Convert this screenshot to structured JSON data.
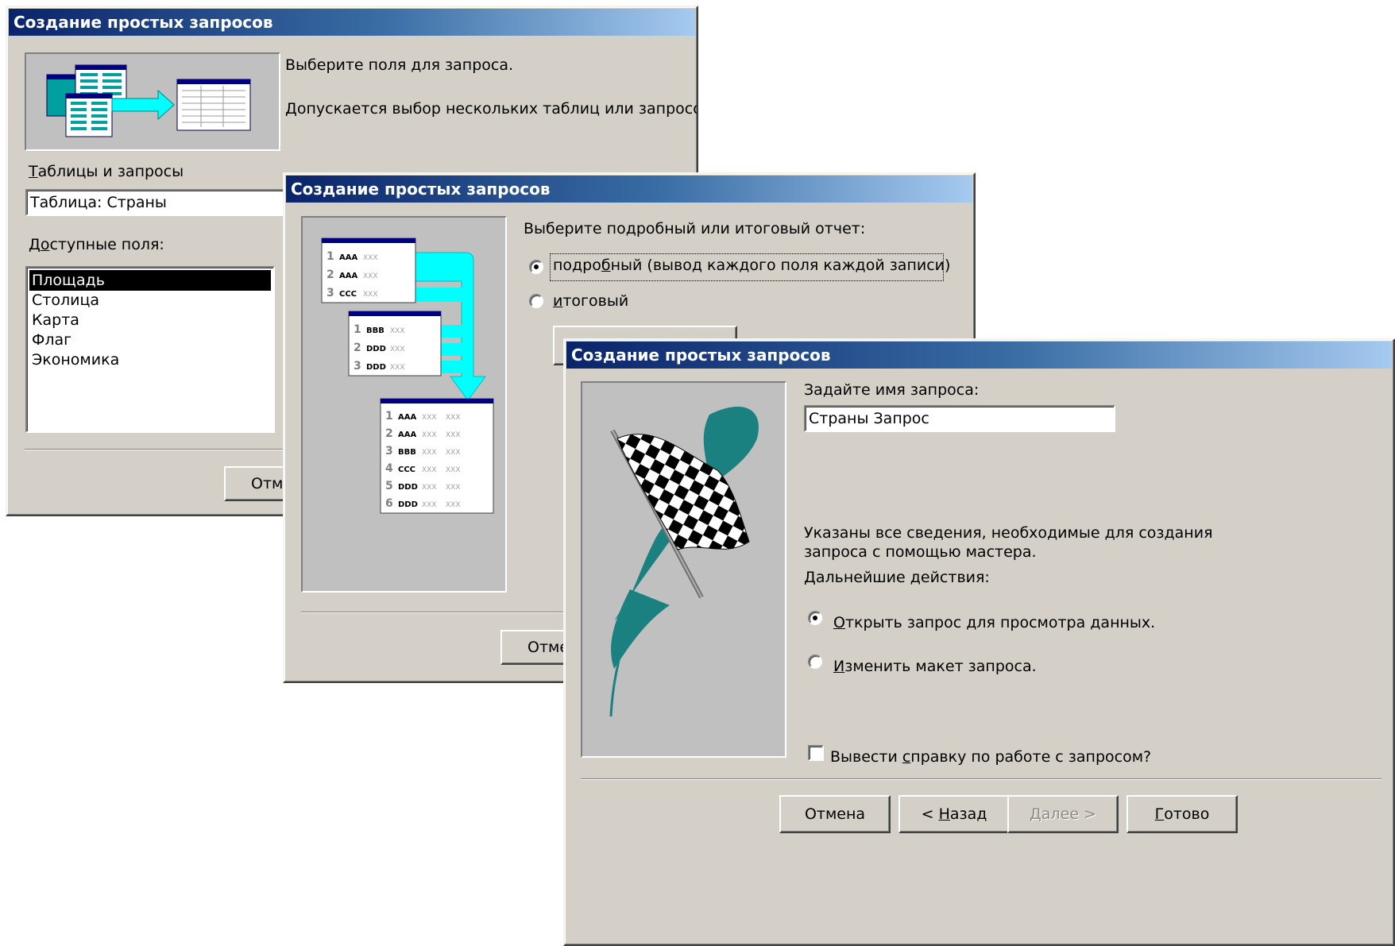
{
  "colors": {
    "dialog_face": "#d4d0c8",
    "title_start": "#0a246a",
    "title_end": "#a6caf0",
    "arrow_cyan": "#00ffff",
    "flag_teal": "#1a8080"
  },
  "dialog1": {
    "title": "Создание простых запросов",
    "line1": "Выберите поля для запроса.",
    "line2": "Допускается выбор нескольких таблиц или запросов.",
    "tables_label_u": "Т",
    "tables_label_rest": "аблицы и запросы",
    "tables_value": "Таблица: Страны",
    "available_label_pre": "Д",
    "available_label_u": "о",
    "available_label_rest": "ступные поля:",
    "fields": [
      "Площадь",
      "Столица",
      "Карта",
      "Флаг",
      "Экономика"
    ],
    "cancel_label": "Отмена"
  },
  "dialog2": {
    "title": "Создание простых запросов",
    "prompt": "Выберите подробный или итоговый отчет:",
    "opt_detail_pre": "подро",
    "opt_detail_u": "б",
    "opt_detail_rest": "ный (вывод каждого поля каждой записи)",
    "opt_summary_u": "и",
    "opt_summary_rest": "тоговый",
    "cancel_label": "Отмена",
    "illus_left": [
      [
        "1",
        "AAA"
      ],
      [
        "2",
        "AAA"
      ],
      [
        "3",
        "CCC"
      ]
    ],
    "illus_mid": [
      [
        "1",
        "BBB"
      ],
      [
        "2",
        "DDD"
      ],
      [
        "3",
        "DDD"
      ]
    ],
    "illus_result": [
      [
        "1",
        "AAA"
      ],
      [
        "2",
        "AAA"
      ],
      [
        "3",
        "BBB"
      ],
      [
        "4",
        "CCC"
      ],
      [
        "5",
        "DDD"
      ],
      [
        "6",
        "DDD"
      ]
    ],
    "illus_filler": "XXX"
  },
  "dialog3": {
    "title": "Создание простых запросов",
    "name_label": "Задайте имя запроса:",
    "name_value": "Страны Запрос",
    "info_line1": "Указаны все сведения, необходимые для создания",
    "info_line2": "запроса с помощью мастера.",
    "next_actions": "Дальнейшие действия:",
    "opt_open_u": "О",
    "opt_open_rest": "ткрыть запрос для просмотра данных.",
    "opt_modify_u": "И",
    "opt_modify_rest": "зменить макет запроса.",
    "help_pre": "Вывести ",
    "help_u": "с",
    "help_rest": "правку по работе с запросом?",
    "btn_cancel": "Отмена",
    "btn_back_pre": "< ",
    "btn_back_u": "Н",
    "btn_back_rest": "азад",
    "btn_next_u": "Д",
    "btn_next_rest": "алее >",
    "btn_finish_u": "Г",
    "btn_finish_rest": "отово"
  }
}
